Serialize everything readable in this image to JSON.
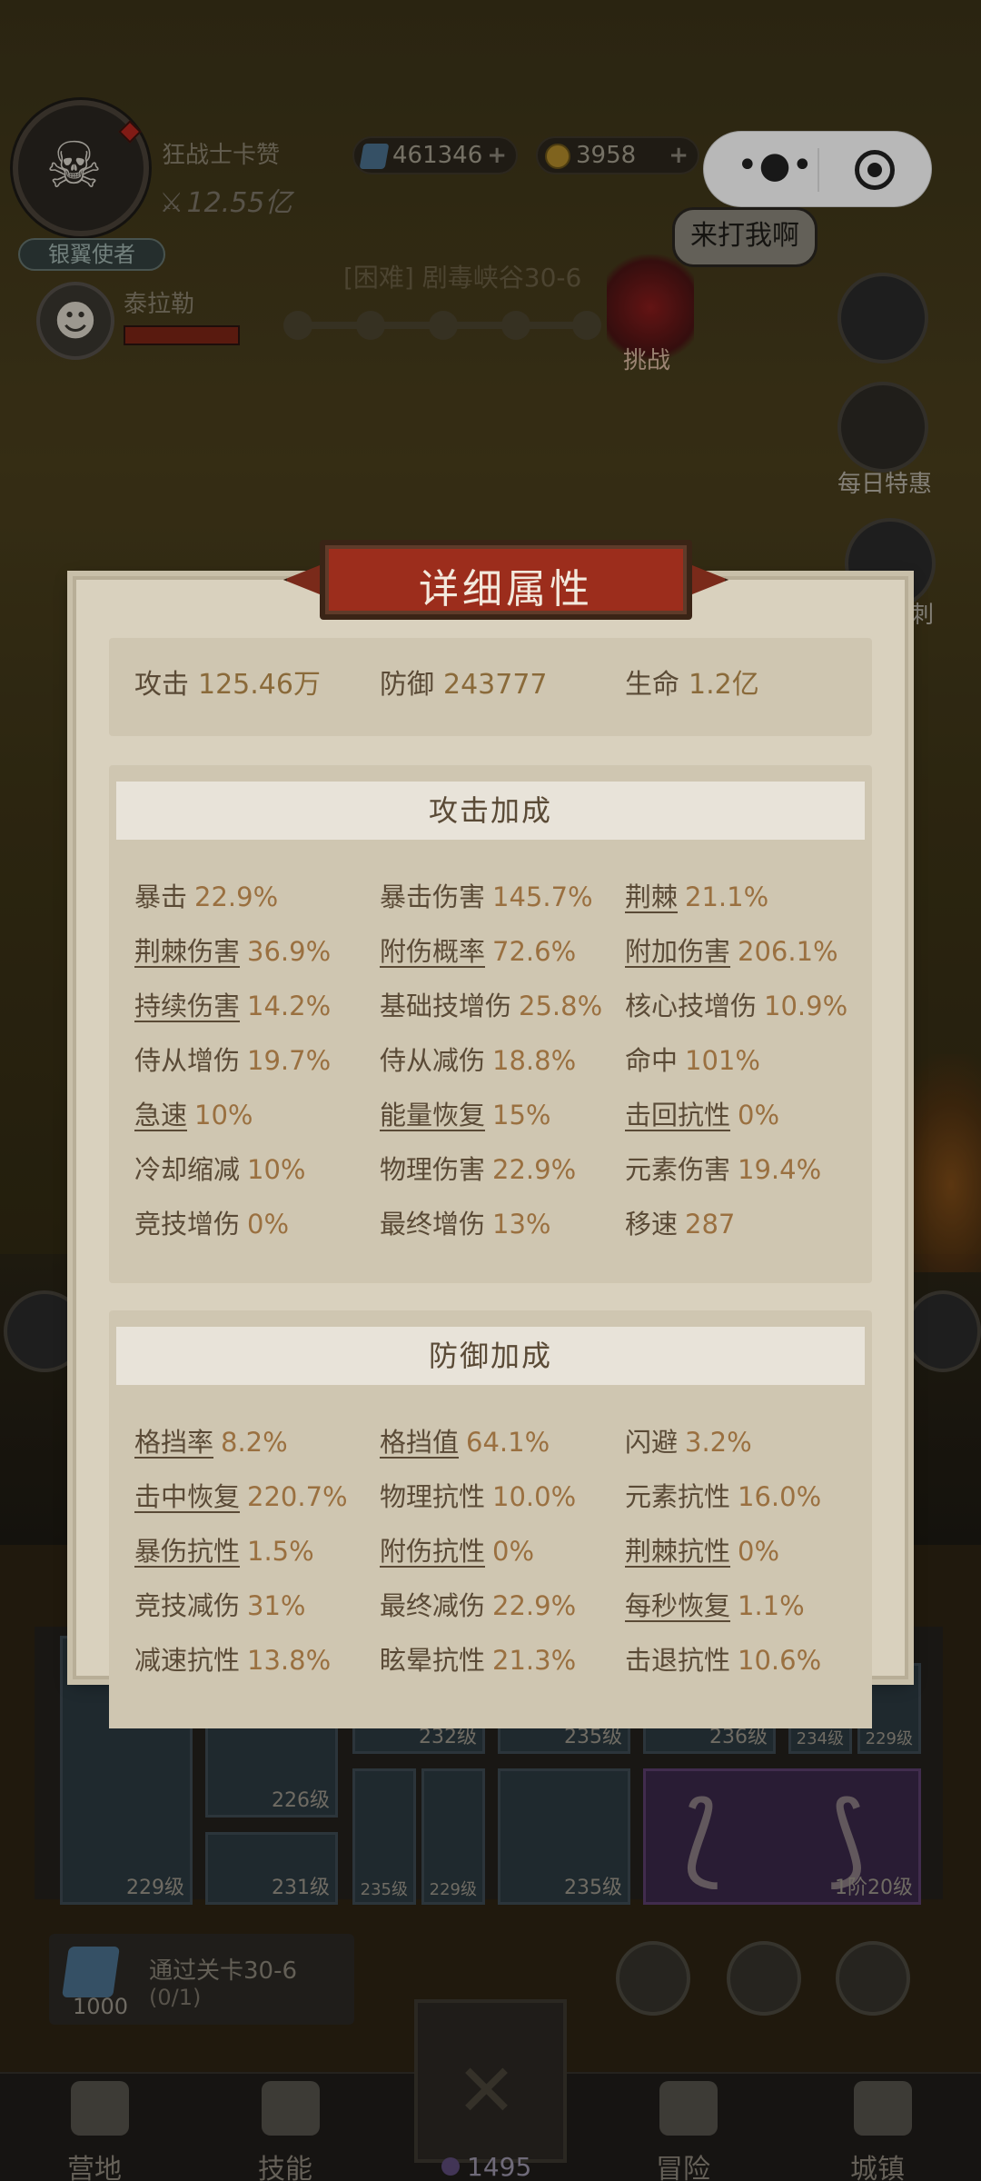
{
  "hud": {
    "player_name": "狂战士卡赞",
    "player_power": "12.55亿",
    "rank": "银翼使者",
    "gems": "461346",
    "coins": "3958",
    "boss_name": "泰拉勒",
    "stage_title": "[困难] 剧毒峡谷30-6",
    "speech": "来打我啊",
    "challenge": "挑战",
    "daily_deal": "每日特惠",
    "side_partial": "刺"
  },
  "modal": {
    "title": "详细属性",
    "base": [
      {
        "label": "攻击",
        "value": "125.46万"
      },
      {
        "label": "防御",
        "value": "243777"
      },
      {
        "label": "生命",
        "value": "1.2亿"
      }
    ],
    "attack": {
      "title": "攻击加成",
      "rows": [
        [
          {
            "label": "暴击",
            "value": "22.9%",
            "u": false
          },
          {
            "label": "暴击伤害",
            "value": "145.7%",
            "u": false
          },
          {
            "label": "荆棘",
            "value": "21.1%",
            "u": true
          }
        ],
        [
          {
            "label": "荆棘伤害",
            "value": "36.9%",
            "u": true
          },
          {
            "label": "附伤概率",
            "value": "72.6%",
            "u": true
          },
          {
            "label": "附加伤害",
            "value": "206.1%",
            "u": true
          }
        ],
        [
          {
            "label": "持续伤害",
            "value": "14.2%",
            "u": true
          },
          {
            "label": "基础技增伤",
            "value": "25.8%",
            "u": false
          },
          {
            "label": "核心技增伤",
            "value": "10.9%",
            "u": false
          }
        ],
        [
          {
            "label": "侍从增伤",
            "value": "19.7%",
            "u": false
          },
          {
            "label": "侍从减伤",
            "value": "18.8%",
            "u": false
          },
          {
            "label": "命中",
            "value": "101%",
            "u": false
          }
        ],
        [
          {
            "label": "急速",
            "value": "10%",
            "u": true
          },
          {
            "label": "能量恢复",
            "value": "15%",
            "u": true
          },
          {
            "label": "击回抗性",
            "value": "0%",
            "u": true
          }
        ],
        [
          {
            "label": "冷却缩减",
            "value": "10%",
            "u": false
          },
          {
            "label": "物理伤害",
            "value": "22.9%",
            "u": false
          },
          {
            "label": "元素伤害",
            "value": "19.4%",
            "u": false
          }
        ],
        [
          {
            "label": "竞技增伤",
            "value": "0%",
            "u": false
          },
          {
            "label": "最终增伤",
            "value": "13%",
            "u": false
          },
          {
            "label": "移速",
            "value": "287",
            "u": false
          }
        ]
      ]
    },
    "defense": {
      "title": "防御加成",
      "rows": [
        [
          {
            "label": "格挡率",
            "value": "8.2%",
            "u": true
          },
          {
            "label": "格挡值",
            "value": "64.1%",
            "u": true
          },
          {
            "label": "闪避",
            "value": "3.2%",
            "u": false
          }
        ],
        [
          {
            "label": "击中恢复",
            "value": "220.7%",
            "u": true
          },
          {
            "label": "物理抗性",
            "value": "10.0%",
            "u": false
          },
          {
            "label": "元素抗性",
            "value": "16.0%",
            "u": false
          }
        ],
        [
          {
            "label": "暴伤抗性",
            "value": "1.5%",
            "u": true
          },
          {
            "label": "附伤抗性",
            "value": "0%",
            "u": true
          },
          {
            "label": "荆棘抗性",
            "value": "0%",
            "u": true
          }
        ],
        [
          {
            "label": "竞技减伤",
            "value": "31%",
            "u": false
          },
          {
            "label": "最终减伤",
            "value": "22.9%",
            "u": false
          },
          {
            "label": "每秒恢复",
            "value": "1.1%",
            "u": true
          }
        ],
        [
          {
            "label": "减速抗性",
            "value": "13.8%",
            "u": false
          },
          {
            "label": "眩晕抗性",
            "value": "21.3%",
            "u": false
          },
          {
            "label": "击退抗性",
            "value": "10.6%",
            "u": false
          }
        ]
      ]
    }
  },
  "equipment": {
    "levels": [
      "229级",
      "226级",
      "231级",
      "232级",
      "235级",
      "229级",
      "235级",
      "236级",
      "234级",
      "229级",
      "235级",
      "1阶20级"
    ]
  },
  "quest": {
    "title": "通过关卡30-6",
    "progress": "(0/1)",
    "reward": "1000"
  },
  "bottom": {
    "tabs": [
      "营地",
      "技能",
      "冒险",
      "城镇"
    ],
    "currency": "1495"
  }
}
